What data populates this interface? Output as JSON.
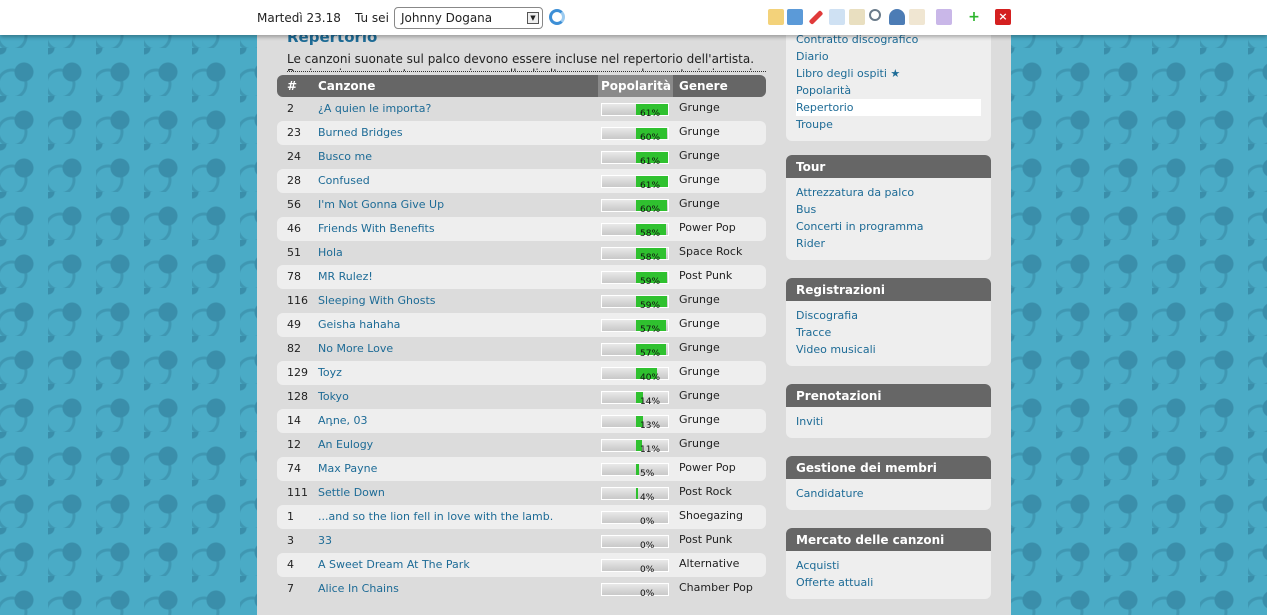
{
  "topbar": {
    "date": "Martedì 23.18",
    "you_are": "Tu sei",
    "user": "Johnny Dogana"
  },
  "page": {
    "title": "Repertorio",
    "intro": "Le canzoni suonate sul palco devono essere incluse nel repertorio dell'artista. Puoi aggiungere le tue canzoni e quelle di altre persone nel repertorio in ogni momento."
  },
  "table": {
    "headers": [
      "#",
      "Canzone",
      "Popolarità",
      "Genere"
    ],
    "rows": [
      {
        "n": "2",
        "song": "¿A quien le importa?",
        "pop": 61,
        "pct": "61%",
        "genre": "Grunge"
      },
      {
        "n": "23",
        "song": "Burned Bridges",
        "pop": 60,
        "pct": "60%",
        "genre": "Grunge"
      },
      {
        "n": "24",
        "song": "Busco me",
        "pop": 61,
        "pct": "61%",
        "genre": "Grunge"
      },
      {
        "n": "28",
        "song": "Confused",
        "pop": 61,
        "pct": "61%",
        "genre": "Grunge"
      },
      {
        "n": "56",
        "song": "I'm Not Gonna Give Up",
        "pop": 60,
        "pct": "60%",
        "genre": "Grunge"
      },
      {
        "n": "46",
        "song": "Friends With Benefits",
        "pop": 58,
        "pct": "58%",
        "genre": "Power Pop"
      },
      {
        "n": "51",
        "song": "Hola",
        "pop": 58,
        "pct": "58%",
        "genre": "Space Rock"
      },
      {
        "n": "78",
        "song": "MR Rulez!",
        "pop": 59,
        "pct": "59%",
        "genre": "Post Punk"
      },
      {
        "n": "116",
        "song": "Sleeping With Ghosts",
        "pop": 59,
        "pct": "59%",
        "genre": "Grunge"
      },
      {
        "n": "49",
        "song": "Geisha hahaha",
        "pop": 57,
        "pct": "57%",
        "genre": "Grunge"
      },
      {
        "n": "82",
        "song": "No More Love",
        "pop": 57,
        "pct": "57%",
        "genre": "Grunge"
      },
      {
        "n": "129",
        "song": "Toyz",
        "pop": 40,
        "pct": "40%",
        "genre": "Grunge"
      },
      {
        "n": "128",
        "song": "Tokyo",
        "pop": 14,
        "pct": "14%",
        "genre": "Grunge"
      },
      {
        "n": "14",
        "song": "Aդne, 03",
        "pop": 13,
        "pct": "13%",
        "genre": "Grunge"
      },
      {
        "n": "12",
        "song": "An Eulogy",
        "pop": 11,
        "pct": "11%",
        "genre": "Grunge"
      },
      {
        "n": "74",
        "song": "Max Payne",
        "pop": 5,
        "pct": "5%",
        "genre": "Power Pop"
      },
      {
        "n": "111",
        "song": "Settle Down",
        "pop": 4,
        "pct": "4%",
        "genre": "Post Rock"
      },
      {
        "n": "1",
        "song": "...and so the lion fell in love with the lamb.",
        "pop": 0,
        "pct": "0%",
        "genre": "Shoegazing"
      },
      {
        "n": "3",
        "song": "33",
        "pop": 0,
        "pct": "0%",
        "genre": "Post Punk"
      },
      {
        "n": "4",
        "song": "A Sweet Dream At The Park",
        "pop": 0,
        "pct": "0%",
        "genre": "Alternative"
      },
      {
        "n": "7",
        "song": "Alice In Chains",
        "pop": 0,
        "pct": "0%",
        "genre": "Chamber Pop"
      }
    ]
  },
  "sidebar": [
    {
      "title": "",
      "items": [
        "Contratto discografico",
        "Diario",
        "Libro degli ospiti ★",
        "Popolarità",
        "Repertorio",
        "Troupe"
      ],
      "selected": 4
    },
    {
      "title": "Tour",
      "items": [
        "Attrezzatura da palco",
        "Bus",
        "Concerti in programma",
        "Rider"
      ]
    },
    {
      "title": "Registrazioni",
      "items": [
        "Discografia",
        "Tracce",
        "Video musicali"
      ]
    },
    {
      "title": "Prenotazioni",
      "items": [
        "Inviti"
      ]
    },
    {
      "title": "Gestione dei membri",
      "items": [
        "Candidature"
      ]
    },
    {
      "title": "Mercato delle canzoni",
      "items": [
        "Acquisti",
        "Offerte attuali"
      ]
    }
  ]
}
